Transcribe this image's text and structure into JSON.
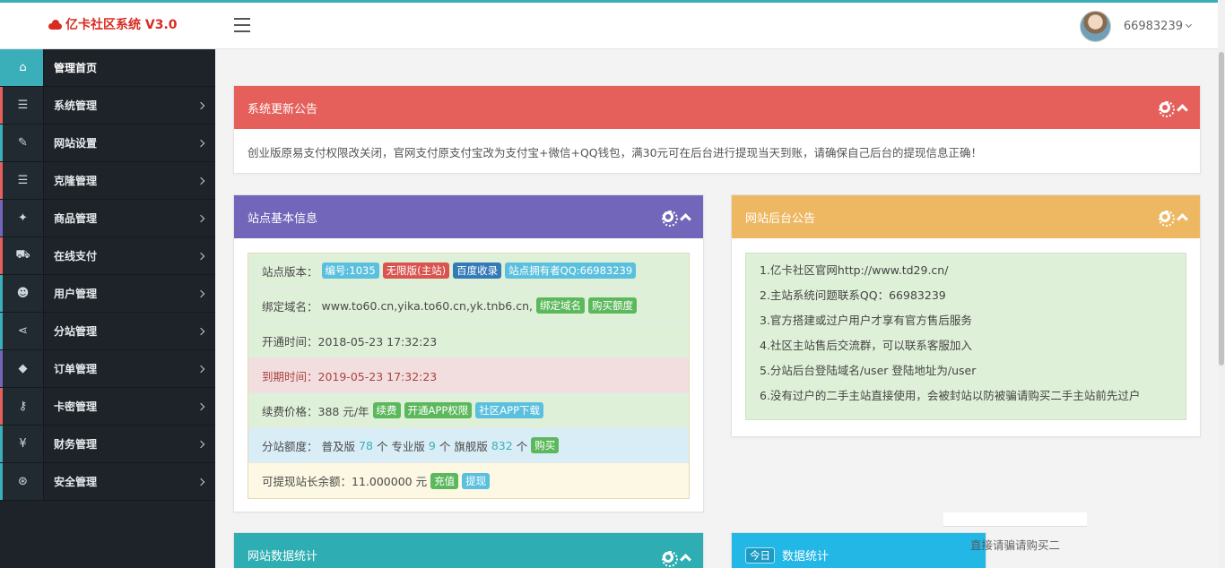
{
  "header": {
    "logo_text": "亿卡社区系统 V3.0",
    "username": "66983239"
  },
  "sidebar": {
    "items": [
      {
        "label": "管理首页",
        "icon": "home-icon"
      },
      {
        "label": "系统管理",
        "icon": "server-icon"
      },
      {
        "label": "网站设置",
        "icon": "edit-icon"
      },
      {
        "label": "克隆管理",
        "icon": "clone-icon"
      },
      {
        "label": "商品管理",
        "icon": "gift-icon"
      },
      {
        "label": "在线支付",
        "icon": "cart-icon"
      },
      {
        "label": "用户管理",
        "icon": "users-icon"
      },
      {
        "label": "分站管理",
        "icon": "share-icon"
      },
      {
        "label": "订单管理",
        "icon": "tags-icon"
      },
      {
        "label": "卡密管理",
        "icon": "key-icon"
      },
      {
        "label": "财务管理",
        "icon": "yen-icon"
      },
      {
        "label": "安全管理",
        "icon": "gamepad-icon"
      }
    ]
  },
  "notice": {
    "title": "系统更新公告",
    "text": "创业版原易支付权限改关闭，官网支付原支付宝改为支付宝+微信+QQ钱包，满30元可在后台进行提现当天到账，请确保自己后台的提现信息正确！"
  },
  "site_info": {
    "title": "站点基本信息",
    "version_label": "站点版本：",
    "version_tags": [
      "编号:1035",
      "无限版(主站)",
      "百度收录",
      "站点拥有者QQ:66983239"
    ],
    "domain_label": "绑定域名：",
    "domain_value": "www.to60.cn,yika.to60.cn,yk.tnb6.cn,",
    "domain_tags": [
      "绑定域名",
      "购买额度"
    ],
    "open_time": "开通时间：2018-05-23 17:32:23",
    "expire_time": "到期时间：2019-05-23 17:32:23",
    "renew_label": "续费价格：388 元/年",
    "renew_tags": [
      "续费",
      "开通APP权限",
      "社区APP下载"
    ],
    "quota_label": "分站额度：",
    "quota_basic_label": "普及版",
    "quota_basic": "78",
    "quota_pro_label": "个 专业版",
    "quota_pro": "9",
    "quota_flag_label": "个 旗舰版",
    "quota_flag": "832",
    "quota_unit": "个",
    "quota_buy": "购买",
    "balance_label": "可提现站长余额：11.000000 元",
    "balance_tags": [
      "充值",
      "提现"
    ]
  },
  "backend_notice": {
    "title": "网站后台公告",
    "lines": [
      "1.亿卡社区官网http://www.td29.cn/",
      "2.主站系统问题联系QQ：66983239",
      "3.官方搭建或过户用户才享有官方售后服务",
      "4.社区主站售后交流群，可以联系客服加入",
      "5.分站后台登陆域名/user 登陆地址为/user",
      "6.没有过户的二手主站直接使用，会被封站以防被骗请购买二手主站前先过户"
    ]
  },
  "stats": {
    "title": "网站数据统计",
    "today_badge": "今日",
    "today_title": "数据统计",
    "ghost_text": "直接请骗请购买二"
  },
  "colors": {
    "accent": "#3aafb9",
    "notice_red": "#e5605a",
    "info_purple": "#7266ba",
    "backend_orange": "#eeb863",
    "stats_teal": "#2eaeb3",
    "today_blue": "#23b7e5"
  }
}
